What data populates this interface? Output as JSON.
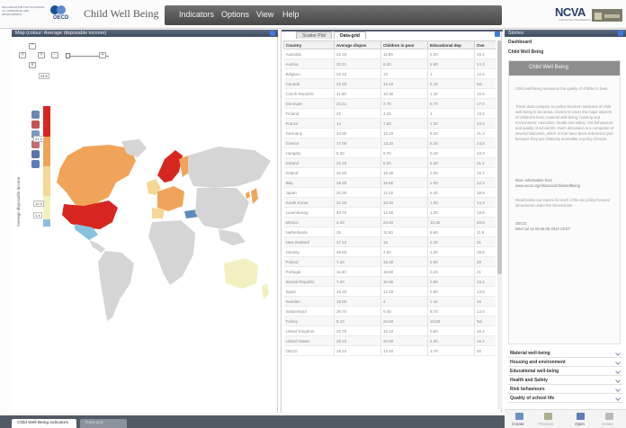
{
  "header": {
    "org_lines": [
      "ORGANISATION FOR ECONOMIC",
      "CO-OPERATION AND",
      "DEVELOPMENT"
    ],
    "org_name": "OECD",
    "app_title": "Child Well Being",
    "menu": [
      "Indicators",
      "Options",
      "View",
      "Help"
    ],
    "partner_logo": "NCVA",
    "partner_sub": "Interactive Visualisation"
  },
  "map_panel": {
    "title": "Map (colour: Average disposable income)",
    "legend_values": [
      "24.5",
      "21.4",
      "12.3",
      "1.4"
    ],
    "legend_title": "Average disposable income",
    "colors": {
      "high": "#d7261f",
      "mid_high": "#f0a45a",
      "mid": "#f5d796",
      "low": "#f2f0bf",
      "lowest": "#87c1de",
      "no_data": "#d5d5d5"
    }
  },
  "table_panel": {
    "tabs": [
      "Scatter Plot",
      "Data-grid"
    ],
    "columns": [
      "Country",
      "Average dispos",
      "Children in poor",
      "Educational dep",
      "Ove"
    ],
    "rows": [
      [
        "Australia",
        "22.40",
        "11.80",
        "2.20",
        "19.1"
      ],
      [
        "Austria",
        "22.21",
        "6.20",
        "6.60",
        "24.3"
      ],
      [
        "Belgium",
        "22.43",
        "10",
        "1",
        "12.6"
      ],
      [
        "Canada",
        "22.40",
        "15.10",
        "2.10",
        "Na"
      ],
      [
        "Czech Republic",
        "11.60",
        "10.30",
        "1.10",
        "16.6"
      ],
      [
        "Denmark",
        "23.21",
        "2.70",
        "8.70",
        "17.0"
      ],
      [
        "Finland",
        "22",
        "4.20",
        "1",
        "13.2"
      ],
      [
        "France",
        "14",
        "7.60",
        "1.20",
        "23.3"
      ],
      [
        "Germany",
        "24.90",
        "10.20",
        "8.20",
        "21.3"
      ],
      [
        "Greece",
        "17.00",
        "13.20",
        "6.20",
        "24.5"
      ],
      [
        "Hungary",
        "8.20",
        "8.70",
        "0.10",
        "23.3"
      ],
      [
        "Iceland",
        "22.10",
        "8.30",
        "6.30",
        "21.1"
      ],
      [
        "Ireland",
        "22.60",
        "16.30",
        "2.00",
        "16.7"
      ],
      [
        "Italy",
        "18.20",
        "15.50",
        "1.00",
        "12.3"
      ],
      [
        "Japan",
        "20.30",
        "12.20",
        "6.40",
        "18.9"
      ],
      [
        "South Korea",
        "21.40",
        "10.20",
        "1.00",
        "14.3"
      ],
      [
        "Luxembourg",
        "40.70",
        "12.90",
        "1.30",
        "19.8"
      ],
      [
        "Mexico",
        "4.40",
        "24.60",
        "10.30",
        "40.9"
      ],
      [
        "Netherlands",
        "25",
        "11.50",
        "8.60",
        "11.8"
      ],
      [
        "New Zealand",
        "17.10",
        "15",
        "2.40",
        "31"
      ],
      [
        "Norway",
        "26.60",
        "4.60",
        "1.20",
        "18.8"
      ],
      [
        "Poland",
        "7.40",
        "15.30",
        "2.80",
        "29"
      ],
      [
        "Portugal",
        "11.80",
        "16.60",
        "2.20",
        "21"
      ],
      [
        "Slovak Republic",
        "7.40",
        "10.90",
        "0.80",
        "16.4"
      ],
      [
        "Spain",
        "16.40",
        "12.20",
        "0.80",
        "13.8"
      ],
      [
        "Sweden",
        "19.90",
        "4",
        "1.40",
        "16"
      ],
      [
        "Switzerland",
        "26.70",
        "9.40",
        "8.70",
        "13.6"
      ],
      [
        "Turkey",
        "5.10",
        "24.60",
        "10.60",
        "Na"
      ],
      [
        "United Kingdom",
        "22.70",
        "10.10",
        "0.80",
        "26.2"
      ],
      [
        "United States",
        "28.10",
        "20.60",
        "4.00",
        "16.2"
      ],
      [
        "OECD",
        "18.10",
        "12.40",
        "3.70",
        "20"
      ]
    ]
  },
  "stories_panel": {
    "title": "Stories",
    "nav": [
      "Dashboard",
      "Child Well Being"
    ],
    "card_title": "Child Well Being",
    "paragraphs": [
      "Child well-being measures the quality of children's lives.",
      "These data compare 21 policy-focused measures of child well-being in six areas, chosen to cover the major aspects of children's lives: material well-being; housing and environment; education; health and safety; risk behaviours; and quality of school life. Each dimension is a composite of several indicators, which in turn have been selected in part because they are relatively amenable to policy choices.",
      "More information from www.oecd.org/els/social/childwellbeing",
      "Read below our stories for each of the six policy-focused dimensions under the Dimensions"
    ],
    "source_label": "OECD,",
    "source_date": "Wed Jul 14 09:36:08 2010 CEST",
    "sections": [
      "Material well-being",
      "Housing and environment",
      "Educational well-being",
      "Health and Safety",
      "Risk behaviours",
      "Quality of school life"
    ],
    "toolbar": [
      "Create",
      "Preview",
      "Open",
      "Delete"
    ]
  },
  "bottom_tabs": [
    "Child Well Being indicators",
    "Data grid"
  ]
}
